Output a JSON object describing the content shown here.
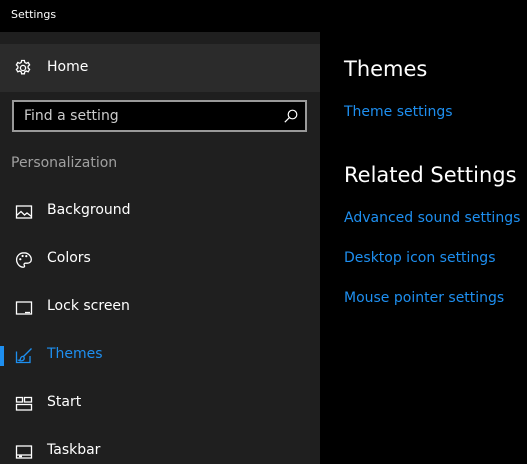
{
  "window": {
    "title": "Settings"
  },
  "sidebar": {
    "home_label": "Home",
    "search": {
      "placeholder": "Find a setting"
    },
    "section_label": "Personalization",
    "items": [
      {
        "label": "Background",
        "icon": "picture-icon"
      },
      {
        "label": "Colors",
        "icon": "palette-icon"
      },
      {
        "label": "Lock screen",
        "icon": "lock-screen-icon"
      },
      {
        "label": "Themes",
        "icon": "themes-brush-icon",
        "active": true
      },
      {
        "label": "Start",
        "icon": "start-tiles-icon"
      },
      {
        "label": "Taskbar",
        "icon": "taskbar-icon"
      }
    ]
  },
  "main": {
    "themes_heading": "Themes",
    "theme_settings_link": "Theme settings",
    "related_heading": "Related Settings",
    "related_links": [
      "Advanced sound settings",
      "Desktop icon settings",
      "Mouse pointer settings"
    ]
  },
  "colors": {
    "accent": "#1e8ff0",
    "sidebar_bg": "#1f1f1f",
    "home_bg": "#2b2b2b",
    "content_bg": "#000000"
  }
}
